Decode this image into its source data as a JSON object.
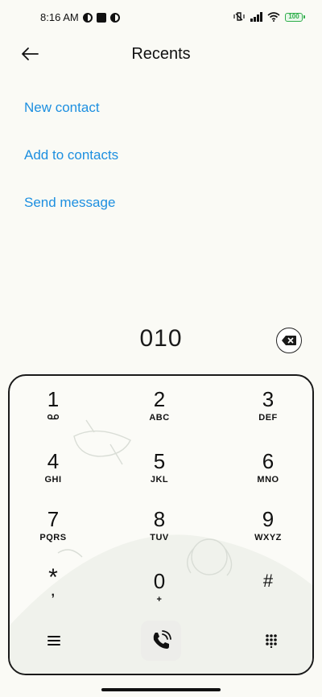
{
  "status_bar": {
    "time": "8:16 AM",
    "battery": "100"
  },
  "header": {
    "title": "Recents"
  },
  "actions": {
    "new_contact": "New contact",
    "add_to_contacts": "Add to contacts",
    "send_message": "Send message"
  },
  "dialer": {
    "number": "010",
    "keys": [
      {
        "digit": "1",
        "letters": ""
      },
      {
        "digit": "2",
        "letters": "ABC"
      },
      {
        "digit": "3",
        "letters": "DEF"
      },
      {
        "digit": "4",
        "letters": "GHI"
      },
      {
        "digit": "5",
        "letters": "JKL"
      },
      {
        "digit": "6",
        "letters": "MNO"
      },
      {
        "digit": "7",
        "letters": "PQRS"
      },
      {
        "digit": "8",
        "letters": "TUV"
      },
      {
        "digit": "9",
        "letters": "WXYZ"
      },
      {
        "digit": "*",
        "letters": ","
      },
      {
        "digit": "0",
        "letters": "+"
      },
      {
        "digit": "#",
        "letters": ""
      }
    ]
  },
  "colors": {
    "accent": "#1d8fe0",
    "background": "#fafaf5",
    "battery": "#2fae4a"
  },
  "icons": {
    "back": "arrow-left-icon",
    "backspace": "backspace-icon",
    "menu": "menu-icon",
    "call": "phone-call-icon",
    "dialpad": "dialpad-icon",
    "voicemail": "voicemail-icon"
  }
}
